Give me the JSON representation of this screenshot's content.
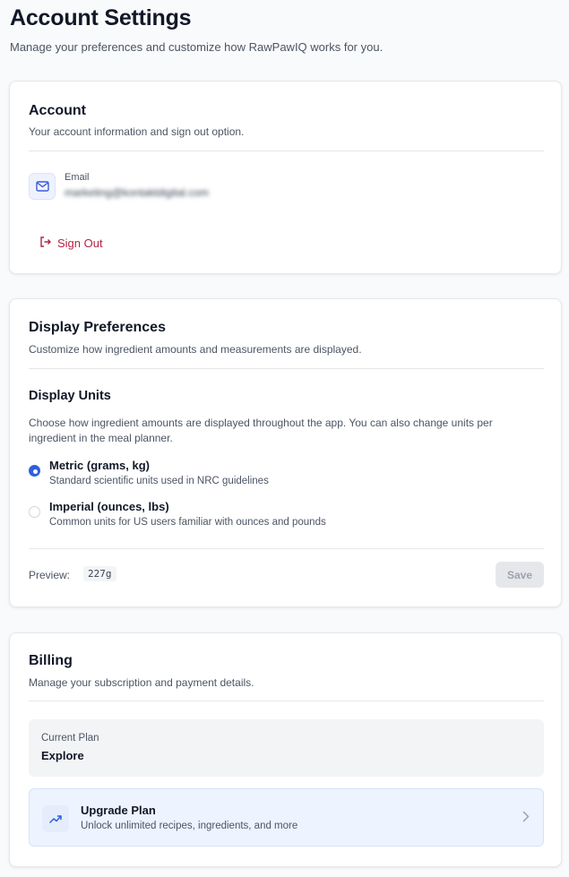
{
  "header": {
    "title": "Account Settings",
    "subtitle": "Manage your preferences and customize how RawPawIQ works for you."
  },
  "account": {
    "title": "Account",
    "description": "Your account information and sign out option.",
    "email_label": "Email",
    "email_value": "marketing@kontaktdigital.com",
    "sign_out_label": "Sign Out",
    "icons": {
      "email": "mail-icon",
      "sign_out": "sign-out-icon"
    }
  },
  "display": {
    "title": "Display Preferences",
    "description": "Customize how ingredient amounts and measurements are displayed.",
    "units_title": "Display Units",
    "units_description": "Choose how ingredient amounts are displayed throughout the app. You can also change units per ingredient in the meal planner.",
    "options": [
      {
        "label": "Metric (grams, kg)",
        "sublabel": "Standard scientific units used in NRC guidelines",
        "selected": true
      },
      {
        "label": "Imperial (ounces, lbs)",
        "sublabel": "Common units for US users familiar with ounces and pounds",
        "selected": false
      }
    ],
    "preview_label": "Preview:",
    "preview_value": "227g",
    "save_label": "Save"
  },
  "billing": {
    "title": "Billing",
    "description": "Manage your subscription and payment details.",
    "current_plan_label": "Current Plan",
    "current_plan_value": "Explore",
    "upgrade_title": "Upgrade Plan",
    "upgrade_description": "Unlock unlimited recipes, ingredients, and more",
    "icons": {
      "upgrade": "trending-up-icon",
      "chevron": "chevron-right-icon"
    }
  },
  "colors": {
    "accent": "#2f5fe0",
    "danger": "#b42345",
    "upgrade_bg": "#edf3ff"
  }
}
